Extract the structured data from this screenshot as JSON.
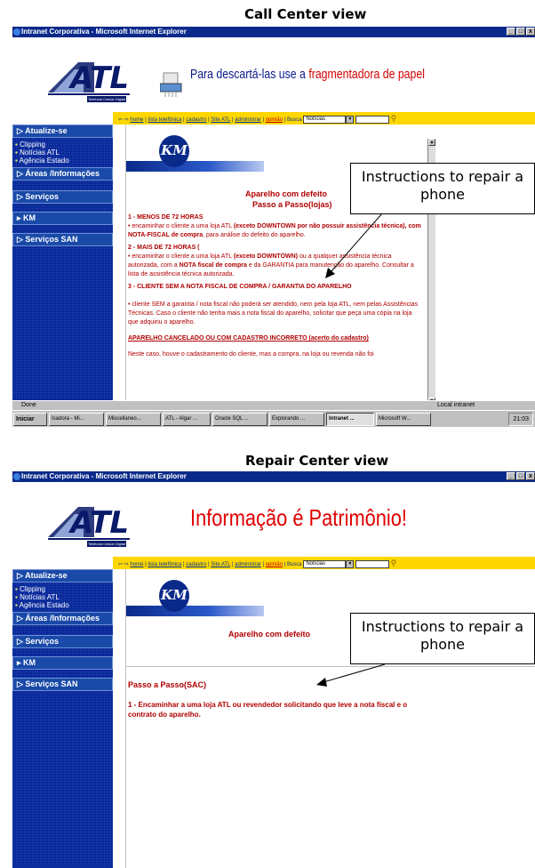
{
  "top": {
    "label": "Call Center  view",
    "window_title": "Intranet Corporativa - Microsoft Internet Explorer",
    "logo": "ATL",
    "logo_tag": "Telefonia Celular Digital",
    "banner_pre": "Para descartá-las use a",
    "banner_red": "fragmentadora de papel",
    "content": {
      "heading": "Aparelho com defeito",
      "subheading": "Passo a Passo(lojas)",
      "s1_title": "1 - MENOS DE 72 HORAS",
      "s1_a": "• encaminhar o cliente a uma loja ATL",
      "s1_b": "(exceto DOWNTOWN por não possuir assistência técnica)",
      "s1_c": ", com NOTA-FISCAL de compra",
      "s1_d": ", para análise do defeito do aparelho.",
      "s2_title": "2 - MAIS DE 72 HORAS (",
      "s2_a": "• encaminhar o cliente a uma loja ATL",
      "s2_b": "(exceto DOWNTOWN)",
      "s2_c": "ou a qualquer assistência técnica autorizada, com a",
      "s2_d": "NOTA fiscal de compra",
      "s2_e": "e da GARANTIA para manutenção do aparelho. Consultar a lista de assistência técnica autorizada.",
      "s3_title": "3 - CLIENTE SEM A NOTA FISCAL DE COMPRA / GARANTIA DO APARELHO",
      "s3_text": "• cliente SEM a garantia / nota fiscal não poderá ser atendido, nem pela loja ATL, nem pelas Assistências Técnicas. Caso o cliente não tenha mais a nota fiscal do aparelho, solicitar que peça uma cópia na loja que adquiriu o aparelho.",
      "s4_title": "APARELHO CANCELADO OU COM CADASTRO INCORRETO (acerto do cadastro)",
      "s4_cut": "Neste caso, houve o cadastramento do cliente, mas a compra, na loja ou revenda não foi"
    },
    "status_left": "Done",
    "status_right": "Local intranet",
    "taskbar": {
      "start": "Iniciar",
      "items": [
        "Isadora - Mi...",
        "Miscellaneo...",
        "ATL - Algar ...",
        "Oracle SQL ...",
        "Explorando ...",
        "Intranet ...",
        "Microsoft W..."
      ],
      "clock": "21:03"
    }
  },
  "bottom": {
    "label": "Repair Center view",
    "window_title": "Intranet Corporativa - Microsoft Internet Explorer",
    "logo": "ATL",
    "logo_tag": "Telefonia Celular Digital",
    "banner": "Informação é Patrimônio!",
    "content": {
      "heading": "Aparelho com defeito",
      "subheading": "Passo a Passo(SAC)",
      "s1": "1 - Encaminhar a uma loja ATL ou revendedor solicitando que leve a nota fiscal e o contrato do aparelho."
    }
  },
  "sidebar": {
    "sections": [
      "Atualize-se",
      "Áreas /Informações",
      "Serviços",
      "KM",
      "Serviços SAN"
    ],
    "links": [
      "Clipping",
      "Notícias ATL",
      "Agência Estado"
    ]
  },
  "toolbar": {
    "links": [
      "home",
      "lista telefônica",
      "cadastro",
      "Site ATL",
      "administrar",
      "opinião"
    ],
    "search_label": "Busca",
    "select_value": "Notícias"
  },
  "km_label": "KM",
  "callout": "Instructions to repair a phone",
  "colors": {
    "sidebar": "#0b2b9b",
    "toolbar": "#ffd700",
    "content_red": "#b00000",
    "titlebar": "#0a2a8a"
  }
}
